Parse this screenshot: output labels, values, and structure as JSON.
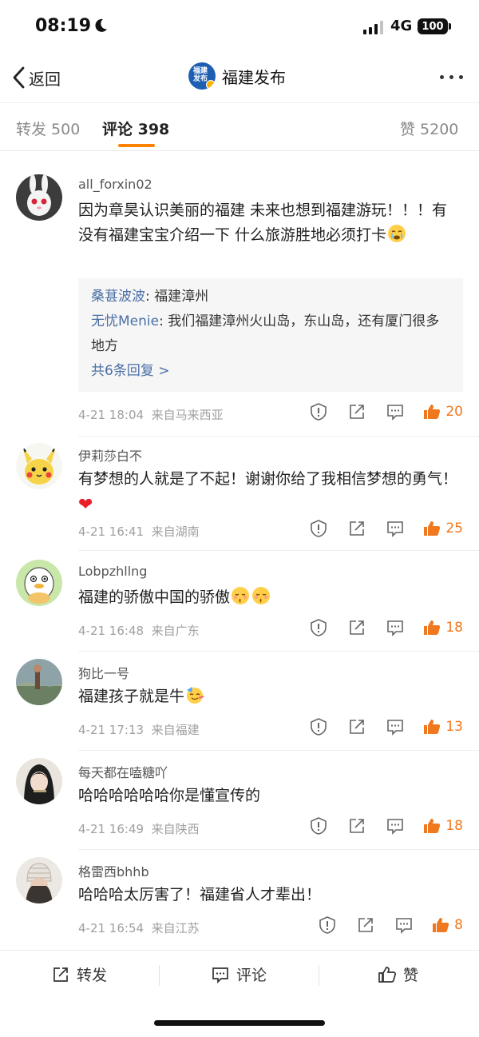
{
  "status_bar": {
    "time": "08:19",
    "network": "4G",
    "battery": "100"
  },
  "nav": {
    "back_label": "返回",
    "account_name": "福建发布",
    "logo_text": "福建\n发布"
  },
  "tabs": {
    "repost": "转发 500",
    "comments": "评论 398",
    "likes": "赞 5200"
  },
  "comments": [
    {
      "user": "all_forxin02",
      "text": "因为章昊认识美丽的福建 未来也想到福建游玩！！！有没有福建宝宝介绍一下 什么旅游胜地必须打卡",
      "replies": [
        {
          "name": "桑葚波波",
          "text": ": 福建漳州"
        },
        {
          "name": "无忧Menie",
          "text": ": 我们福建漳州火山岛，东山岛，还有厦门很多地方"
        }
      ],
      "more_replies": "共6条回复 >",
      "date": "4-21 18:04",
      "location": "来自马来西亚",
      "likes": "20"
    },
    {
      "user": "伊莉莎白不",
      "text": "有梦想的人就是了不起！谢谢你给了我相信梦想的勇气！",
      "date": "4-21 16:41",
      "location": "来自湖南",
      "likes": "25"
    },
    {
      "user": "Lobpzhllng",
      "text": "福建的骄傲中国的骄傲",
      "date": "4-21 16:48",
      "location": "来自广东",
      "likes": "18"
    },
    {
      "user": "狗比一号",
      "text": "福建孩子就是牛",
      "date": "4-21 17:13",
      "location": "来自福建",
      "likes": "13"
    },
    {
      "user": "每天都在嗑糖吖",
      "text": "哈哈哈哈哈哈你是懂宣传的",
      "date": "4-21 16:49",
      "location": "来自陕西",
      "likes": "18"
    },
    {
      "user": "格雷西bhhb",
      "text": "哈哈哈太厉害了！福建省人才辈出！",
      "date": "4-21 16:54",
      "location": "来自江苏",
      "likes": "8"
    }
  ],
  "bottom_bar": {
    "repost": "转发",
    "comment": "评论",
    "like": "赞"
  },
  "colors": {
    "accent": "#ff8200",
    "like": "#f0781e",
    "link": "#4a6fa5"
  }
}
